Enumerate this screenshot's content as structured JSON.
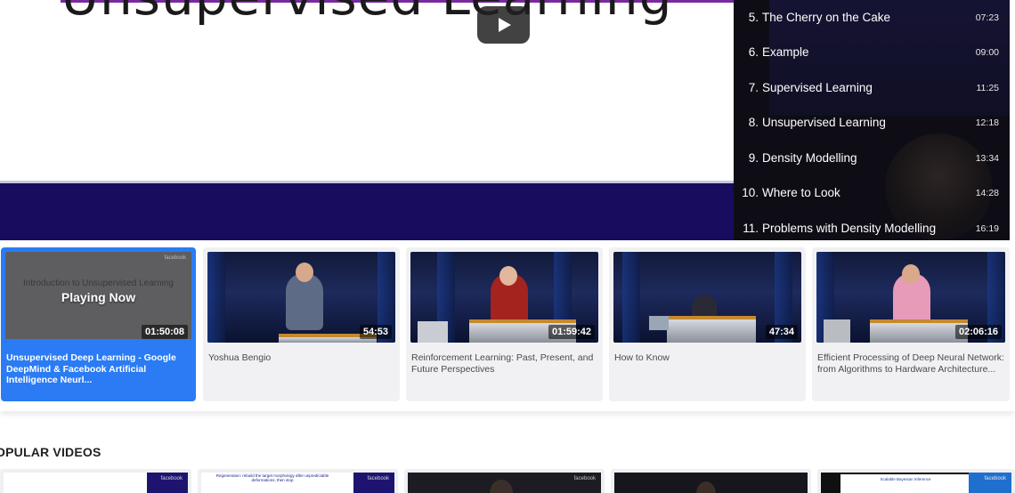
{
  "player": {
    "slide_title": "Unsupervised Learning",
    "play_icon": "play-icon"
  },
  "chapters": [
    {
      "num": "5.",
      "title": "The Cherry on the Cake",
      "time": "07:23"
    },
    {
      "num": "6.",
      "title": "Example",
      "time": "09:00"
    },
    {
      "num": "7.",
      "title": "Supervised Learning",
      "time": "11:25"
    },
    {
      "num": "8.",
      "title": "Unsupervised Learning",
      "time": "12:18"
    },
    {
      "num": "9.",
      "title": "Density Modelling",
      "time": "13:34"
    },
    {
      "num": "10.",
      "title": "Where to Look",
      "time": "14:28"
    },
    {
      "num": "11.",
      "title": "Problems with Density Modelling",
      "time": "16:19"
    }
  ],
  "related": [
    {
      "title": "Unsupervised Deep Learning - Google DeepMind & Facebook Artificial Intelligence Neurl...",
      "duration": "01:50:08",
      "status": "Playing Now",
      "thumb_text": "Introduction to Unsupervised Learning",
      "brand": "facebook",
      "active": true
    },
    {
      "title": "Yoshua Bengio",
      "duration": "54:53"
    },
    {
      "title": "Reinforcement Learning: Past, Present, and Future Perspectives",
      "duration": "01:59:42"
    },
    {
      "title": "How to Know",
      "duration": "47:34"
    },
    {
      "title": "Efficient Processing of Deep Neural Network: from Algorithms to Hardware Architecture...",
      "duration": "02:06:16"
    }
  ],
  "popular": {
    "heading": "OPULAR VIDEOS",
    "cards": [
      {
        "brand": "facebook"
      },
      {
        "brand": "facebook",
        "slide_text": "Regeneration: rebuild the target morphology after unpredictable deformations, then stop"
      },
      {
        "brand": "facebook"
      },
      {},
      {
        "brand": "facebook",
        "slide_text": "Scalable Bayesian Inference"
      }
    ]
  },
  "colors": {
    "accent": "#2a7bf4",
    "slide_footer": "#180c5e",
    "slide_top_bar": "#7a2aa0",
    "chapter_bg": "#0e0d16"
  }
}
